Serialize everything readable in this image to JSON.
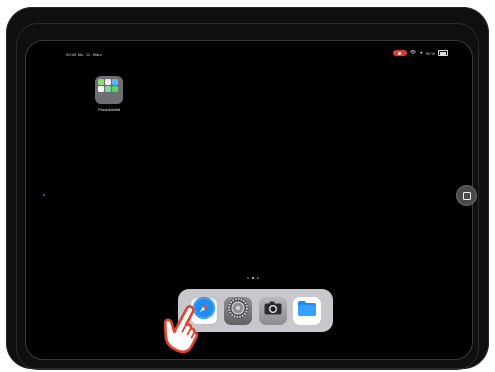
{
  "status_bar": {
    "time_date": "09:45  Mo. 11. März",
    "battery_text": "90 %"
  },
  "home_screen": {
    "folder": {
      "label": "Produktivität",
      "mini_icon_colors": [
        "#8ee06a",
        "#e9e9e9",
        "#59b7ff",
        "#ffffff",
        "#7dd6a3",
        "#5fd25f"
      ]
    },
    "page_indicator": {
      "count": 3,
      "active_index": 1
    }
  },
  "dock": {
    "apps": [
      {
        "name": "Safari",
        "icon": "safari-icon"
      },
      {
        "name": "Einstellungen",
        "icon": "settings-icon"
      },
      {
        "name": "Kamera",
        "icon": "camera-icon"
      },
      {
        "name": "Dateien",
        "icon": "files-icon"
      }
    ]
  },
  "colors": {
    "recording_indicator": "#e23a30",
    "dock_background": "#c8c8cc",
    "screen_background": "#000000"
  },
  "overlay": {
    "pointer_icon": "tap-hand-icon"
  }
}
